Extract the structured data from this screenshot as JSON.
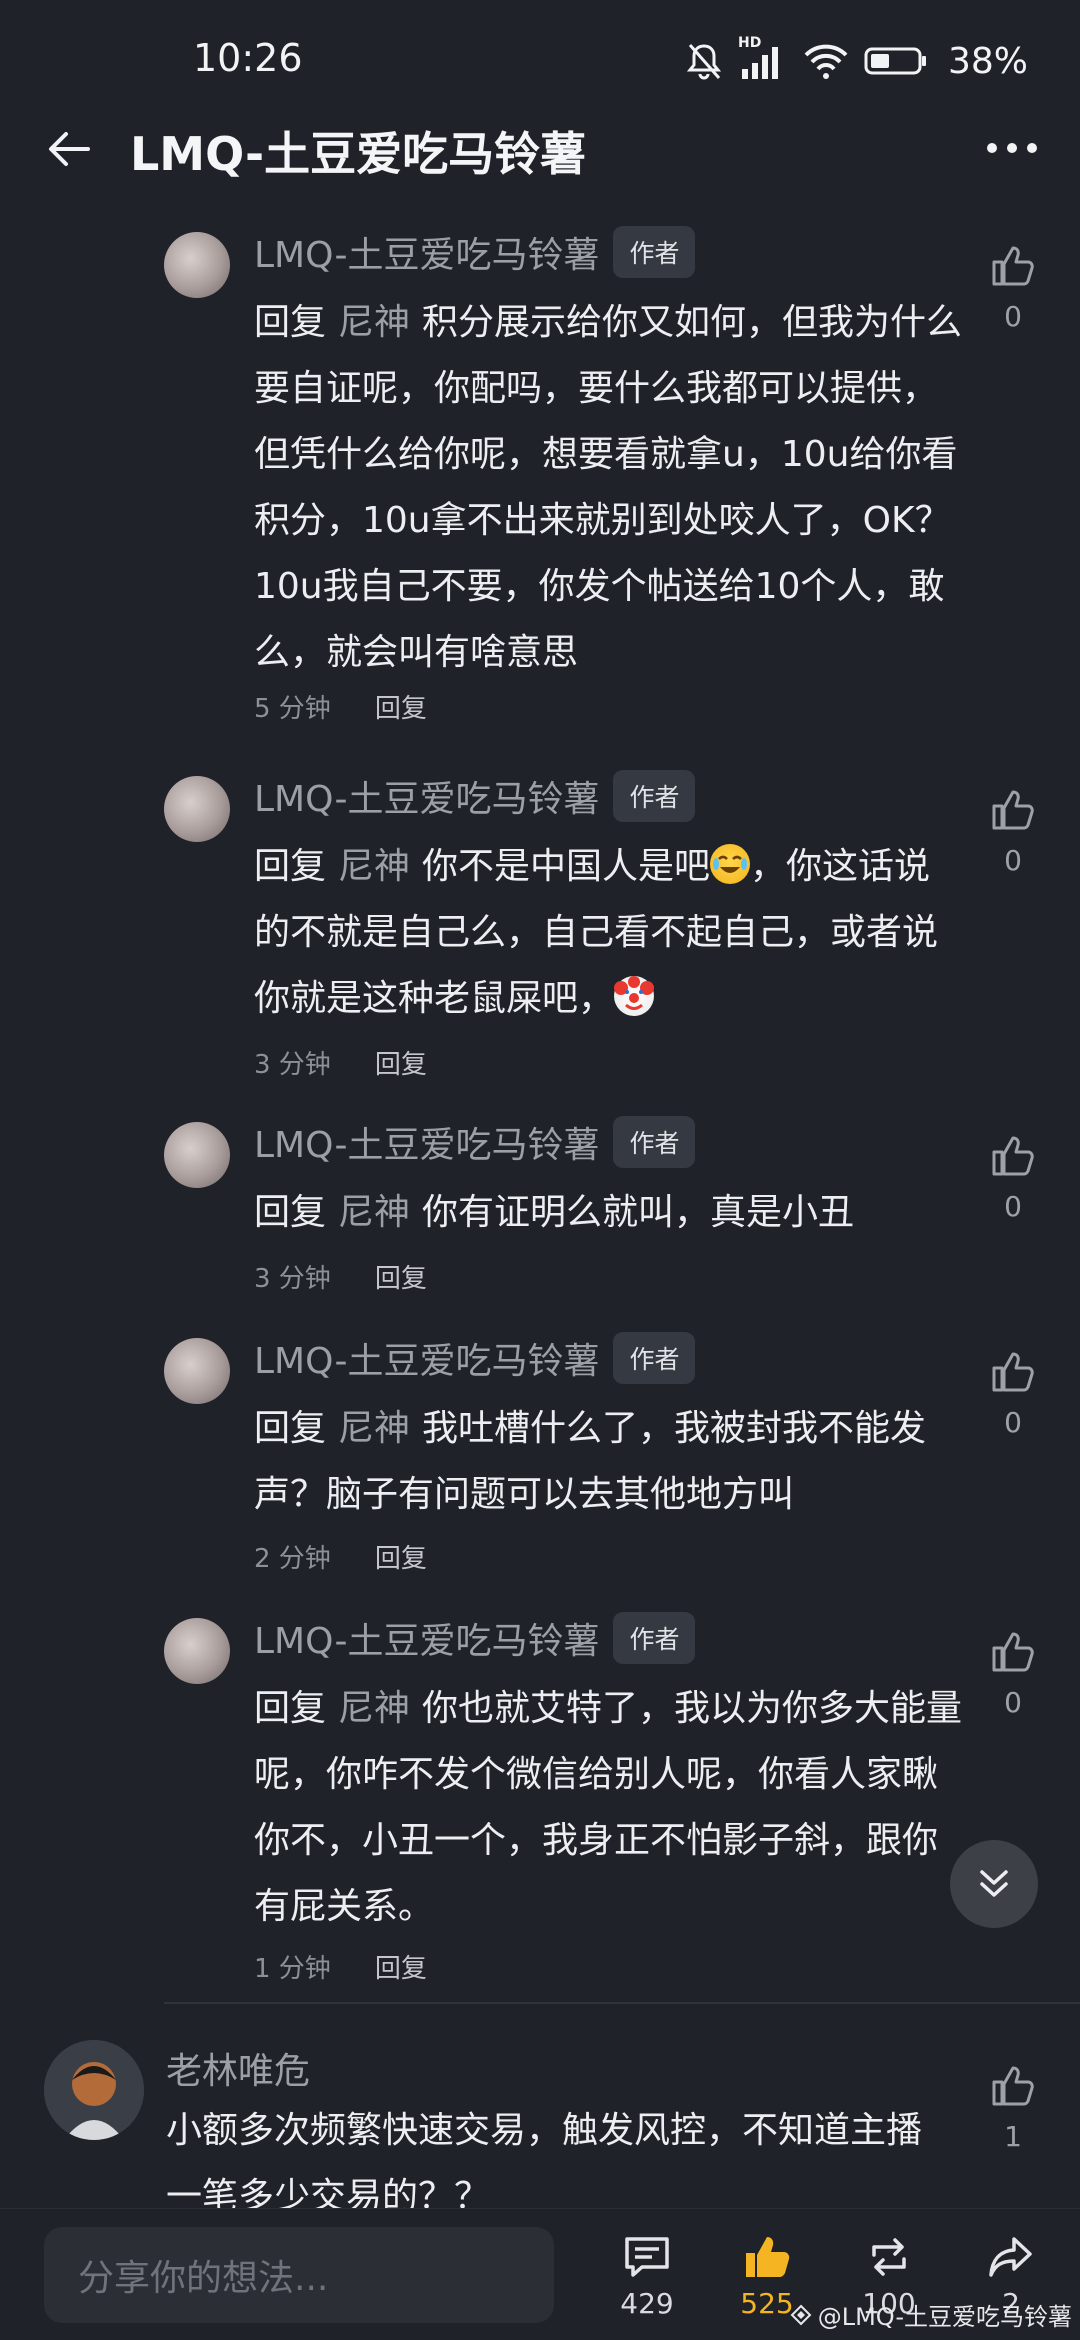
{
  "status": {
    "time": "10:26",
    "network": "HD",
    "battery": "38%"
  },
  "header": {
    "title": "LMQ-土豆爱吃马铃薯",
    "more": "•••"
  },
  "comments": [
    {
      "author": "LMQ-土豆爱吃马铃薯",
      "badge": "作者",
      "reply_prefix": "回复",
      "reply_to": "尼神",
      "text": "积分展示给你又如何，但我为什么要自证呢，你配吗，要什么我都可以提供，但凭什么给你呢，想要看就拿u，10u给你看积分，10u拿不出来就别到处咬人了，OK？10u我自己不要，你发个帖送给10个人，敢么，就会叫有啥意思",
      "time": "5 分钟",
      "reply_btn": "回复",
      "likes": "0"
    },
    {
      "author": "LMQ-土豆爱吃马铃薯",
      "badge": "作者",
      "reply_prefix": "回复",
      "reply_to": "尼神",
      "text_a": "你不是中国人是吧",
      "text_b": "，你这话说的不就是自己么，自己看不起自己，或者说你就是这种老鼠屎吧，",
      "time": "3 分钟",
      "reply_btn": "回复",
      "likes": "0"
    },
    {
      "author": "LMQ-土豆爱吃马铃薯",
      "badge": "作者",
      "reply_prefix": "回复",
      "reply_to": "尼神",
      "text": "你有证明么就叫，真是小丑",
      "time": "3 分钟",
      "reply_btn": "回复",
      "likes": "0"
    },
    {
      "author": "LMQ-土豆爱吃马铃薯",
      "badge": "作者",
      "reply_prefix": "回复",
      "reply_to": "尼神",
      "text": "我吐槽什么了，我被封我不能发声？脑子有问题可以去其他地方叫",
      "time": "2 分钟",
      "reply_btn": "回复",
      "likes": "0"
    },
    {
      "author": "LMQ-土豆爱吃马铃薯",
      "badge": "作者",
      "reply_prefix": "回复",
      "reply_to": "尼神",
      "text": "你也就艾特了，我以为你多大能量呢，你咋不发个微信给别人呢，你看人家瞅你不，小丑一个，我身正不怕影子斜，跟你有屁关系。",
      "time": "1 分钟",
      "reply_btn": "回复",
      "likes": "0"
    }
  ],
  "top_comment": {
    "author": "老林唯危",
    "text": "小额多次频繁快速交易，触发风控，不知道主播一笔多少交易的？？",
    "likes": "1"
  },
  "bottom": {
    "placeholder": "分享你的想法...",
    "comments_count": "429",
    "likes_count": "525",
    "reposts_count": "100",
    "shares_count": "2",
    "watermark": "@LMQ-土豆爱吃马铃薯"
  },
  "colors": {
    "background": "#1f2228",
    "like_active": "#f5b522",
    "muted": "#9c9fa6"
  }
}
